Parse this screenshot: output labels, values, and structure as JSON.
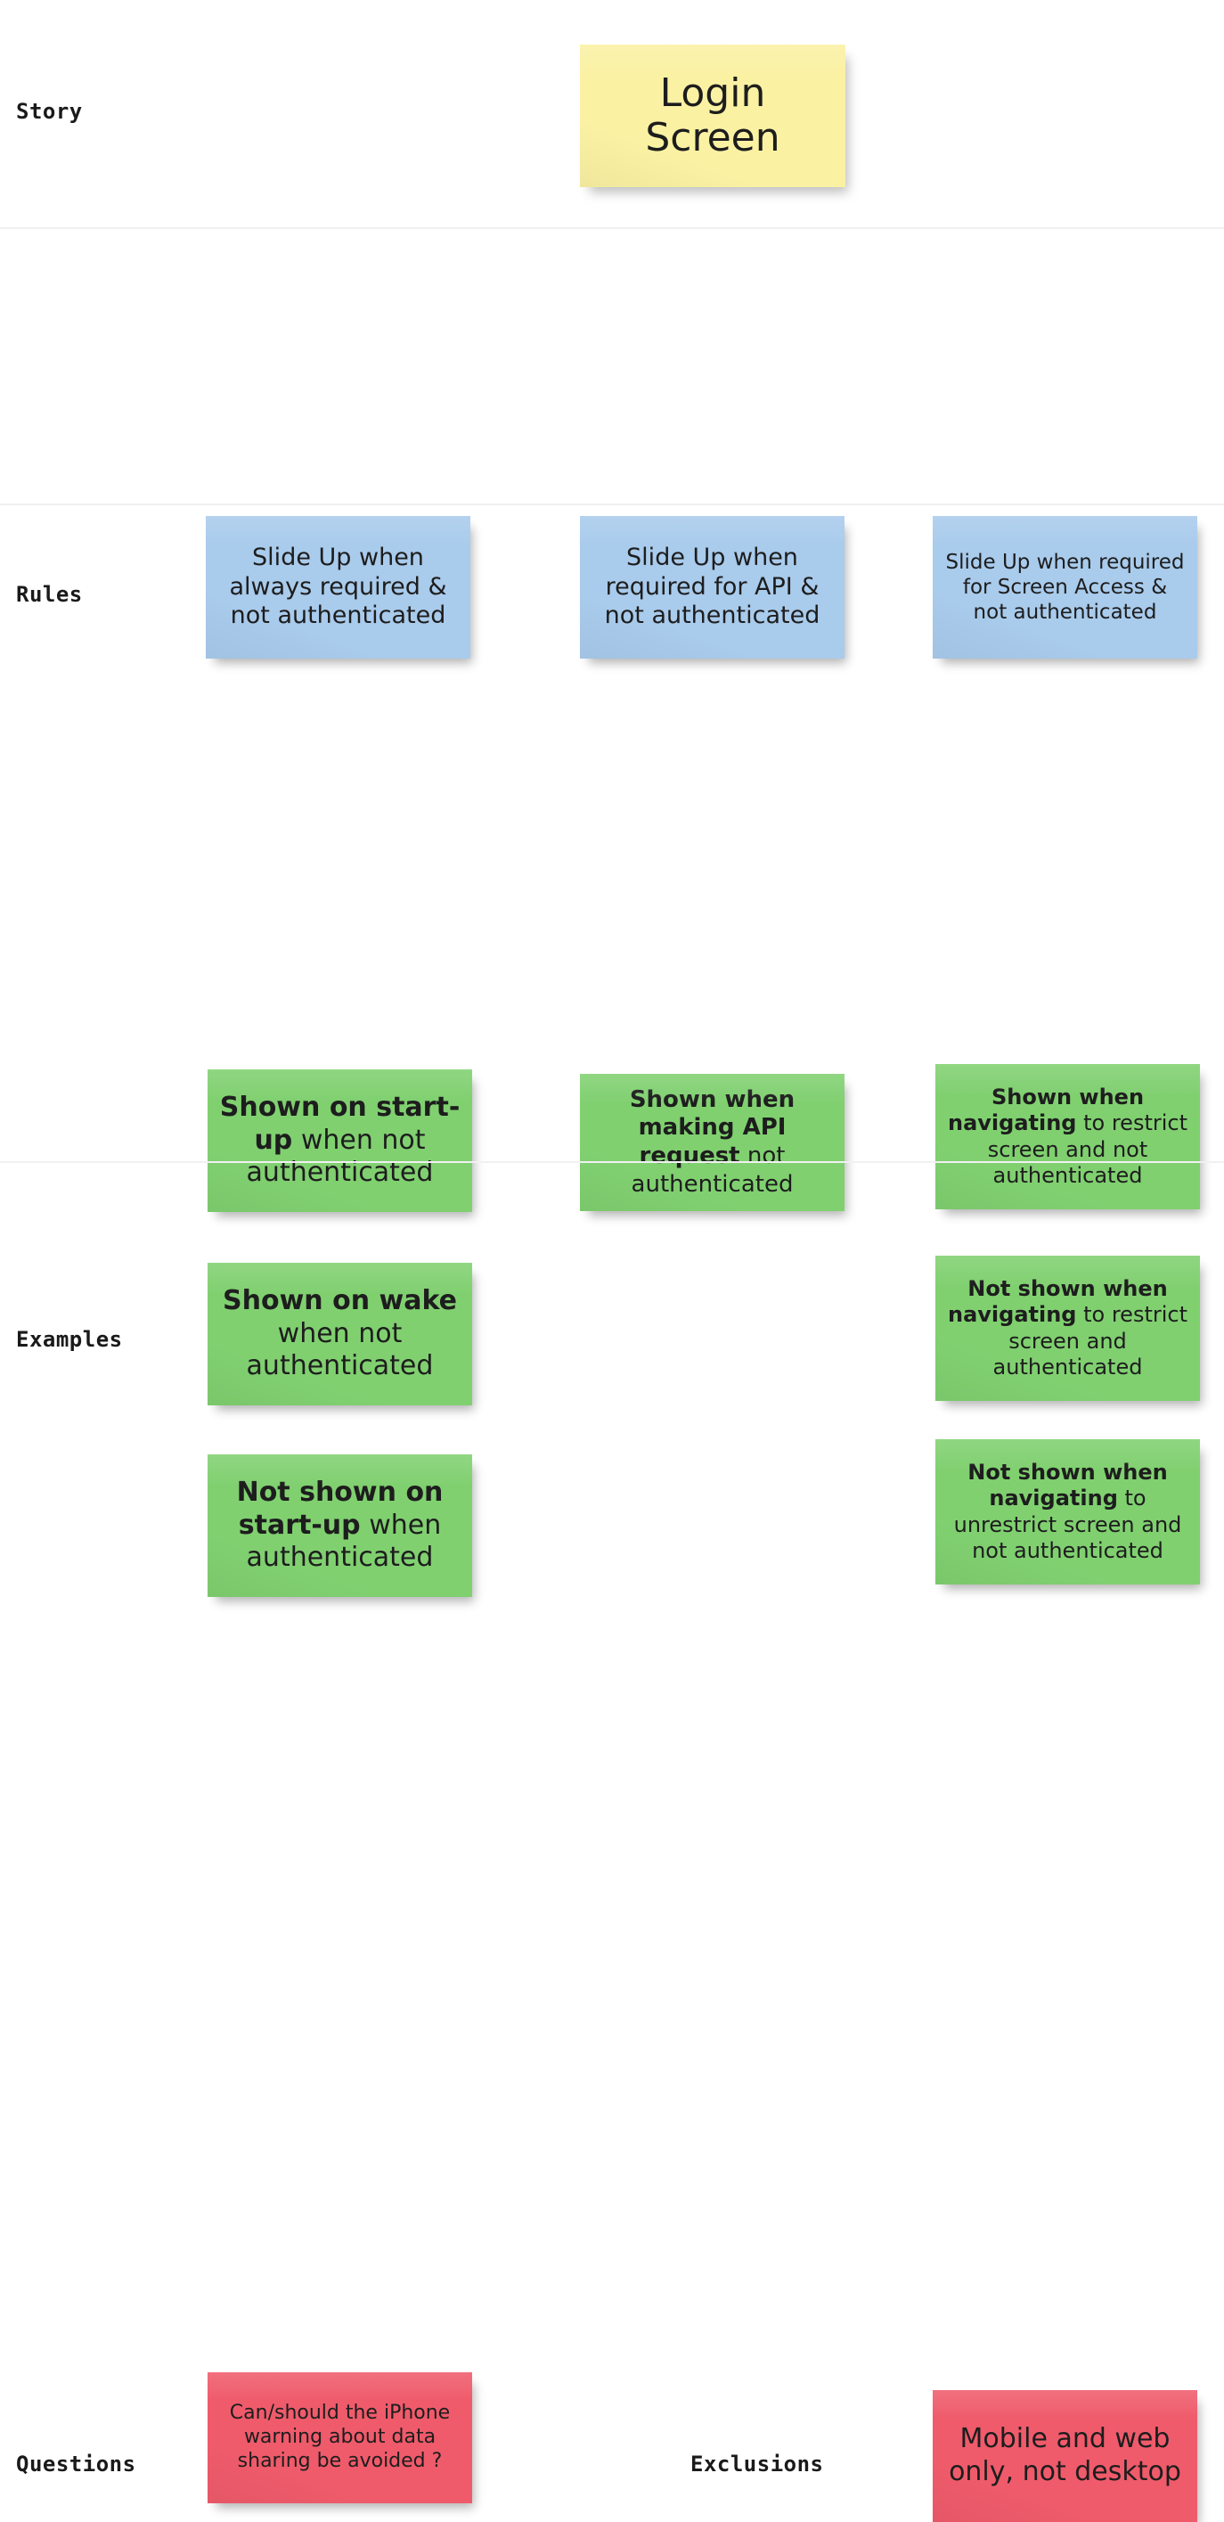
{
  "board": {
    "title": "Example Mapping board",
    "colors": {
      "story_note": "#faf1a3",
      "rule_note": "#a9cbec",
      "example_note": "#80d070",
      "question_note": "#ef5b6b",
      "divider": "#f1f1f2",
      "background": "#ffffff",
      "text": "#1d1d1d"
    }
  },
  "rows": {
    "story": {
      "label": "Story",
      "note": {
        "line1": "Login",
        "line2": "Screen"
      }
    },
    "rules": {
      "label": "Rules",
      "notes": [
        {
          "text": "Slide Up when always required & not authenticated"
        },
        {
          "text": "Slide Up when required for API & not authenticated"
        },
        {
          "text": "Slide Up when required for Screen Access & not authenticated"
        }
      ]
    },
    "examples": {
      "label": "Examples",
      "notes": [
        {
          "bold": "Shown on start-up",
          "rest": " when not authenticated"
        },
        {
          "bold": "Shown on wake",
          "rest": " when not authenticated"
        },
        {
          "bold": "Not shown on start-up",
          "rest": " when authenticated"
        },
        {
          "bold": "Shown when making API request",
          "rest": " not authenticated"
        },
        {
          "bold": "Shown when navigating",
          "rest": " to restrict screen and not authenticated"
        },
        {
          "bold": "Not shown when navigating",
          "rest": " to restrict screen and authenticated"
        },
        {
          "bold": "Not shown when navigating",
          "rest": " to unrestrict screen and not authenticated"
        }
      ]
    },
    "questions": {
      "label": "Questions",
      "notes": [
        {
          "text": "Can/should the iPhone warning about data sharing be avoided  ?"
        }
      ]
    },
    "exclusions": {
      "label": "Exclusions",
      "notes": [
        {
          "text": "Mobile and web only, not desktop"
        }
      ]
    }
  }
}
